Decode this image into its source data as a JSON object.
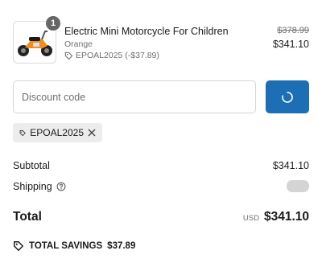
{
  "item": {
    "quantity": "1",
    "name": "Electric Mini Motorcycle For Children",
    "variant": "Orange",
    "discount": "EPOAL2025 (-$37.89)",
    "original_price": "$378.99",
    "price": "$341.10",
    "icons": {
      "discount": "tag-icon"
    }
  },
  "discount_form": {
    "placeholder": "Discount code",
    "apply_icon": "loading-spinner-icon",
    "button_color": "#1c6eb5"
  },
  "applied_code": {
    "code": "EPOAL2025",
    "icons": {
      "tag": "tag-icon",
      "remove": "close-icon"
    }
  },
  "summary": {
    "subtotal_label": "Subtotal",
    "subtotal_value": "$341.10",
    "shipping_label": "Shipping",
    "shipping_icon": "question-circle-icon",
    "total_label": "Total",
    "currency": "USD",
    "total_value": "$341.10"
  },
  "savings": {
    "label": "TOTAL SAVINGS",
    "value": "$37.89",
    "icon": "tag-icon"
  }
}
